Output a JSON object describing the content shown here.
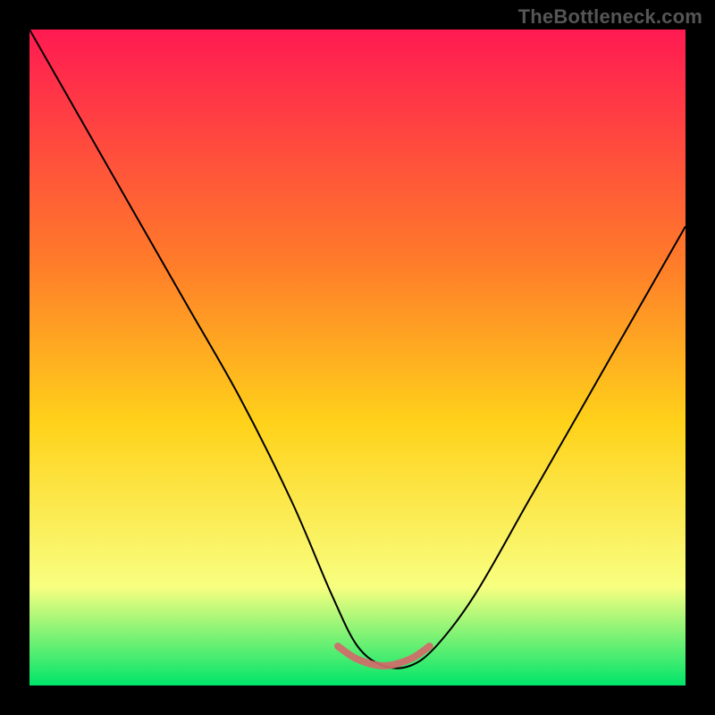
{
  "watermark": "TheBottleneck.com",
  "colors": {
    "frame": "#000000",
    "gradient_top": "#ff1a52",
    "gradient_mid_upper": "#ff7a2a",
    "gradient_mid": "#ffd21a",
    "gradient_lower": "#f8ff80",
    "gradient_base": "#00e56a",
    "curve": "#000000",
    "trough": "#d26a6a"
  },
  "chart_data": {
    "type": "line",
    "title": "",
    "xlabel": "",
    "ylabel": "",
    "xlim": [
      0,
      100
    ],
    "ylim": [
      0,
      100
    ],
    "series": [
      {
        "name": "curve",
        "x": [
          0,
          8,
          16,
          24,
          32,
          40,
          46,
          50,
          54,
          58,
          62,
          68,
          76,
          84,
          92,
          100
        ],
        "y": [
          100,
          86,
          72,
          58,
          44,
          28,
          14,
          6,
          3,
          3,
          6,
          14,
          28,
          42,
          56,
          70
        ]
      },
      {
        "name": "trough-highlight",
        "x": [
          47,
          50,
          54,
          58,
          61
        ],
        "y": [
          6,
          4,
          3,
          4,
          6
        ]
      }
    ]
  }
}
